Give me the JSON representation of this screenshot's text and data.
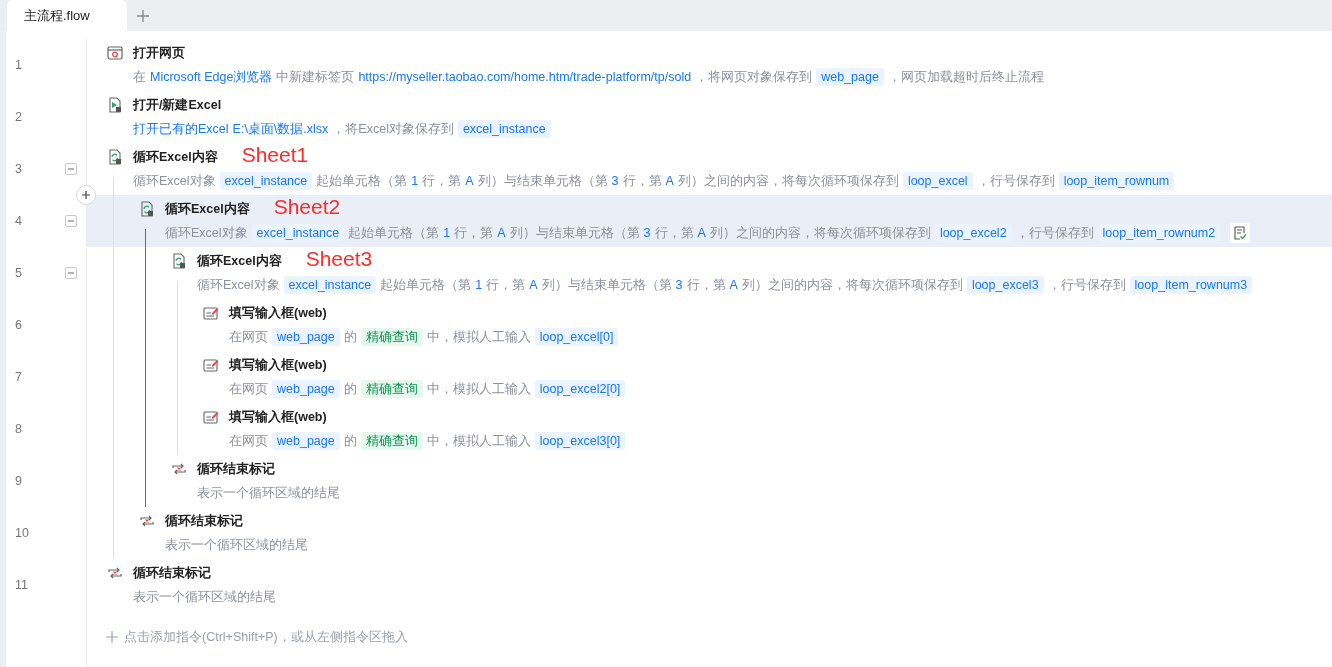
{
  "tabs": [
    {
      "label": "主流程.flow",
      "selected": true
    }
  ],
  "steps": [
    {
      "number": "1",
      "kind": "browser",
      "title": "打开网页",
      "selected": false,
      "description": [
        {
          "kind": "text",
          "text": "在"
        },
        {
          "kind": "value",
          "text": "Microsoft Edge浏览器"
        },
        {
          "kind": "text",
          "text": "中新建标签页"
        },
        {
          "kind": "value",
          "text": "https://myseller.taobao.com/home.htm/trade-platform/tp/sold"
        },
        {
          "kind": "text",
          "text": "，将网页对象保存到"
        },
        {
          "kind": "var",
          "text": "web_page"
        },
        {
          "kind": "text",
          "text": "，网页加载超时后终止流程"
        }
      ]
    },
    {
      "number": "2",
      "kind": "excel-open",
      "title": "打开/新建Excel",
      "selected": false,
      "description": [
        {
          "kind": "value",
          "text": "打开已有的Excel"
        },
        {
          "kind": "value",
          "text": "E:\\桌面\\数据.xlsx"
        },
        {
          "kind": "text",
          "text": "，将Excel对象保存到"
        },
        {
          "kind": "var",
          "text": "excel_instance"
        }
      ]
    },
    {
      "number": "3",
      "kind": "excel-loop",
      "title": "循环Excel内容",
      "note": "Sheet1",
      "expanded": true,
      "selected": false,
      "description": [
        {
          "kind": "text",
          "text": "循环Excel对象"
        },
        {
          "kind": "var",
          "text": "excel_instance"
        },
        {
          "kind": "text",
          "text": "起始单元格（第"
        },
        {
          "kind": "value",
          "text": "1"
        },
        {
          "kind": "text",
          "text": "行，第"
        },
        {
          "kind": "value",
          "text": "A"
        },
        {
          "kind": "text",
          "text": "列）与结束单元格（第"
        },
        {
          "kind": "value",
          "text": "3"
        },
        {
          "kind": "text",
          "text": "行，第"
        },
        {
          "kind": "value",
          "text": "A"
        },
        {
          "kind": "text",
          "text": "列）之间的内容，将每次循环项保存到"
        },
        {
          "kind": "var",
          "text": "loop_excel"
        },
        {
          "kind": "text",
          "text": "，行号保存到"
        },
        {
          "kind": "var",
          "text": "loop_item_rownum"
        }
      ],
      "children": [
        {
          "number": "4",
          "kind": "excel-loop",
          "title": "循环Excel内容",
          "note": "Sheet2",
          "expanded": true,
          "selected": true,
          "description": [
            {
              "kind": "text",
              "text": "循环Excel对象"
            },
            {
              "kind": "var",
              "text": "excel_instance"
            },
            {
              "kind": "text",
              "text": "起始单元格（第"
            },
            {
              "kind": "value",
              "text": "1"
            },
            {
              "kind": "text",
              "text": "行，第"
            },
            {
              "kind": "value",
              "text": "A"
            },
            {
              "kind": "text",
              "text": "列）与结束单元格（第"
            },
            {
              "kind": "value",
              "text": "3"
            },
            {
              "kind": "text",
              "text": "行，第"
            },
            {
              "kind": "value",
              "text": "A"
            },
            {
              "kind": "text",
              "text": "列）之间的内容，将每次循环项保存到"
            },
            {
              "kind": "var",
              "text": "loop_excel2"
            },
            {
              "kind": "text",
              "text": "，行号保存到"
            },
            {
              "kind": "var",
              "text": "loop_item_rownum2"
            }
          ],
          "children": [
            {
              "number": "5",
              "kind": "excel-loop",
              "title": "循环Excel内容",
              "note": "Sheet3",
              "expanded": true,
              "selected": false,
              "description": [
                {
                  "kind": "text",
                  "text": "循环Excel对象"
                },
                {
                  "kind": "var",
                  "text": "excel_instance"
                },
                {
                  "kind": "text",
                  "text": "起始单元格（第"
                },
                {
                  "kind": "value",
                  "text": "1"
                },
                {
                  "kind": "text",
                  "text": "行，第"
                },
                {
                  "kind": "value",
                  "text": "A"
                },
                {
                  "kind": "text",
                  "text": "列）与结束单元格（第"
                },
                {
                  "kind": "value",
                  "text": "3"
                },
                {
                  "kind": "text",
                  "text": "行，第"
                },
                {
                  "kind": "value",
                  "text": "A"
                },
                {
                  "kind": "text",
                  "text": "列）之间的内容，将每次循环项保存到"
                },
                {
                  "kind": "var",
                  "text": "loop_excel3"
                },
                {
                  "kind": "text",
                  "text": "，行号保存到"
                },
                {
                  "kind": "var",
                  "text": "loop_item_rownum3"
                }
              ],
              "children": [
                {
                  "number": "6",
                  "kind": "input",
                  "title": "填写输入框(web)",
                  "selected": false,
                  "description": [
                    {
                      "kind": "text",
                      "text": "在网页"
                    },
                    {
                      "kind": "var",
                      "text": "web_page"
                    },
                    {
                      "kind": "text",
                      "text": "的"
                    },
                    {
                      "kind": "element",
                      "text": "精确查询"
                    },
                    {
                      "kind": "text",
                      "text": "中，模拟人工输入"
                    },
                    {
                      "kind": "var",
                      "text": "loop_excel[0]"
                    }
                  ]
                },
                {
                  "number": "7",
                  "kind": "input",
                  "title": "填写输入框(web)",
                  "selected": false,
                  "description": [
                    {
                      "kind": "text",
                      "text": "在网页"
                    },
                    {
                      "kind": "var",
                      "text": "web_page"
                    },
                    {
                      "kind": "text",
                      "text": "的"
                    },
                    {
                      "kind": "element",
                      "text": "精确查询"
                    },
                    {
                      "kind": "text",
                      "text": "中，模拟人工输入"
                    },
                    {
                      "kind": "var",
                      "text": "loop_excel2[0]"
                    }
                  ]
                },
                {
                  "number": "8",
                  "kind": "input",
                  "title": "填写输入框(web)",
                  "selected": false,
                  "description": [
                    {
                      "kind": "text",
                      "text": "在网页"
                    },
                    {
                      "kind": "var",
                      "text": "web_page"
                    },
                    {
                      "kind": "text",
                      "text": "的"
                    },
                    {
                      "kind": "element",
                      "text": "精确查询"
                    },
                    {
                      "kind": "text",
                      "text": "中，模拟人工输入"
                    },
                    {
                      "kind": "var",
                      "text": "loop_excel3[0]"
                    }
                  ]
                }
              ]
            },
            {
              "number": "9",
              "kind": "loop-end",
              "title": "循环结束标记",
              "selected": false,
              "description": [
                {
                  "kind": "text",
                  "text": "表示一个循环区域的结尾"
                }
              ]
            }
          ]
        },
        {
          "number": "10",
          "kind": "loop-end",
          "title": "循环结束标记",
          "selected": false,
          "description": [
            {
              "kind": "text",
              "text": "表示一个循环区域的结尾"
            }
          ]
        }
      ]
    },
    {
      "number": "11",
      "kind": "loop-end",
      "title": "循环结束标记",
      "selected": false,
      "description": [
        {
          "kind": "text",
          "text": "表示一个循环区域的结尾"
        }
      ]
    }
  ],
  "add_hint": "点击添加指令(Ctrl+Shift+P)，或从左侧指令区拖入"
}
